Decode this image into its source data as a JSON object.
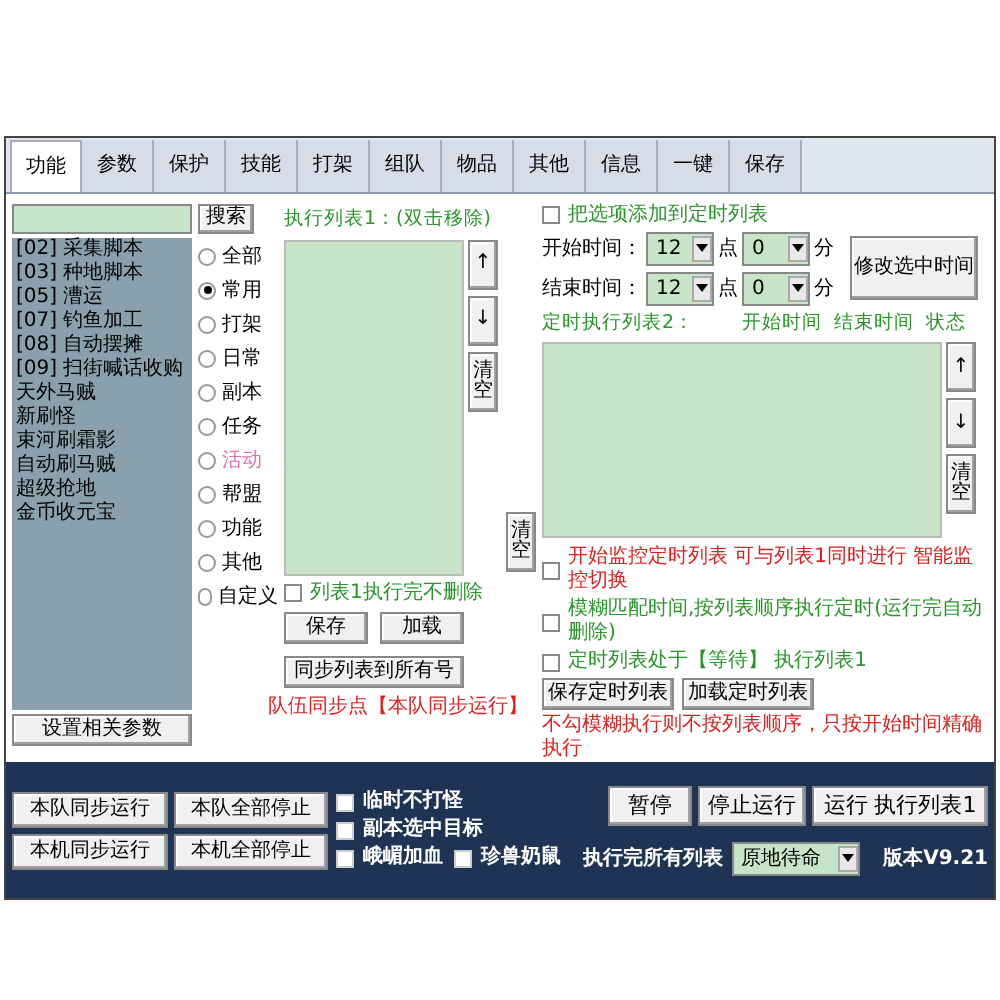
{
  "tabs": [
    {
      "label": "功能",
      "selected": true
    },
    {
      "label": "参数",
      "selected": false
    },
    {
      "label": "保护",
      "selected": false
    },
    {
      "label": "技能",
      "selected": false
    },
    {
      "label": "打架",
      "selected": false
    },
    {
      "label": "组队",
      "selected": false
    },
    {
      "label": "物品",
      "selected": false
    },
    {
      "label": "其他",
      "selected": false
    },
    {
      "label": "信息",
      "selected": false
    },
    {
      "label": "一键",
      "selected": false
    },
    {
      "label": "保存",
      "selected": false
    }
  ],
  "search_button": "搜索",
  "script_list": [
    "[02] 采集脚本",
    "[03] 种地脚本",
    "[05] 漕运",
    "[07] 钓鱼加工",
    "[08] 自动摆摊",
    "[09] 扫街喊话收购",
    "天外马贼",
    "新刷怪",
    "束河刷霜影",
    "自动刷马贼",
    "超级抢地",
    "金币收元宝"
  ],
  "settings_button": "设置相关参数",
  "categories": [
    {
      "label": "全部",
      "selected": false,
      "color": "#000000"
    },
    {
      "label": "常用",
      "selected": true,
      "color": "#000000"
    },
    {
      "label": "打架",
      "selected": false,
      "color": "#000000"
    },
    {
      "label": "日常",
      "selected": false,
      "color": "#000000"
    },
    {
      "label": "副本",
      "selected": false,
      "color": "#000000"
    },
    {
      "label": "任务",
      "selected": false,
      "color": "#000000"
    },
    {
      "label": "活动",
      "selected": false,
      "color": "#e070b8"
    },
    {
      "label": "帮盟",
      "selected": false,
      "color": "#000000"
    },
    {
      "label": "功能",
      "selected": false,
      "color": "#000000"
    },
    {
      "label": "其他",
      "selected": false,
      "color": "#000000"
    },
    {
      "label": "自定义",
      "selected": false,
      "color": "#000000"
    }
  ],
  "list1": {
    "title": "执行列表1：(双击移除)",
    "up": "↑",
    "down": "↓",
    "clear": "清空",
    "keep": {
      "label": "列表1执行完不删除",
      "checked": false
    },
    "save": "保存",
    "load": "加载",
    "sync": "同步列表到所有号",
    "note": "队伍同步点【本队同步运行】"
  },
  "timer": {
    "add": {
      "label": "把选项添加到定时列表",
      "checked": false
    },
    "start": {
      "label": "开始时间：",
      "hour": "12",
      "hour_unit": "点",
      "minute": "0",
      "minute_unit": "分"
    },
    "end": {
      "label": "结束时间：",
      "hour": "12",
      "hour_unit": "点",
      "minute": "0",
      "minute_unit": "分"
    },
    "modify": "修改选中时间",
    "list2_title": "定时执行列表2：",
    "columns": [
      "开始时间",
      "结束时间",
      "状态"
    ],
    "up": "↑",
    "down": "↓",
    "clear": "清空",
    "clear_left": "清空",
    "options": [
      {
        "label": "开始监控定时列表 可与列表1同时进行 智能监控切换",
        "checked": false,
        "color": "#e02020"
      },
      {
        "label": "模糊匹配时间,按列表顺序执行定时(运行完自动删除)",
        "checked": false,
        "color": "#2a962a"
      },
      {
        "label": "定时列表处于【等待】 执行列表1",
        "checked": false,
        "color": "#2a962a"
      }
    ],
    "save": "保存定时列表",
    "load": "加载定时列表",
    "note": "不勾模糊执行则不按列表顺序，只按开始时间精确执行"
  },
  "bottom": {
    "left_buttons": [
      "本队同步运行",
      "本队全部停止",
      "本机同步运行",
      "本机全部停止"
    ],
    "checks": [
      {
        "label": "临时不打怪",
        "checked": false
      },
      {
        "label": "副本选中目标",
        "checked": false
      },
      {
        "label": "峨嵋加血",
        "checked": false
      },
      {
        "label": "珍兽奶鼠",
        "checked": false
      }
    ],
    "pause": "暂停",
    "stop": "停止运行",
    "run": "运行 执行列表1",
    "after_label": "执行完所有列表",
    "after_value": "原地待命",
    "version": "版本V9.21"
  }
}
